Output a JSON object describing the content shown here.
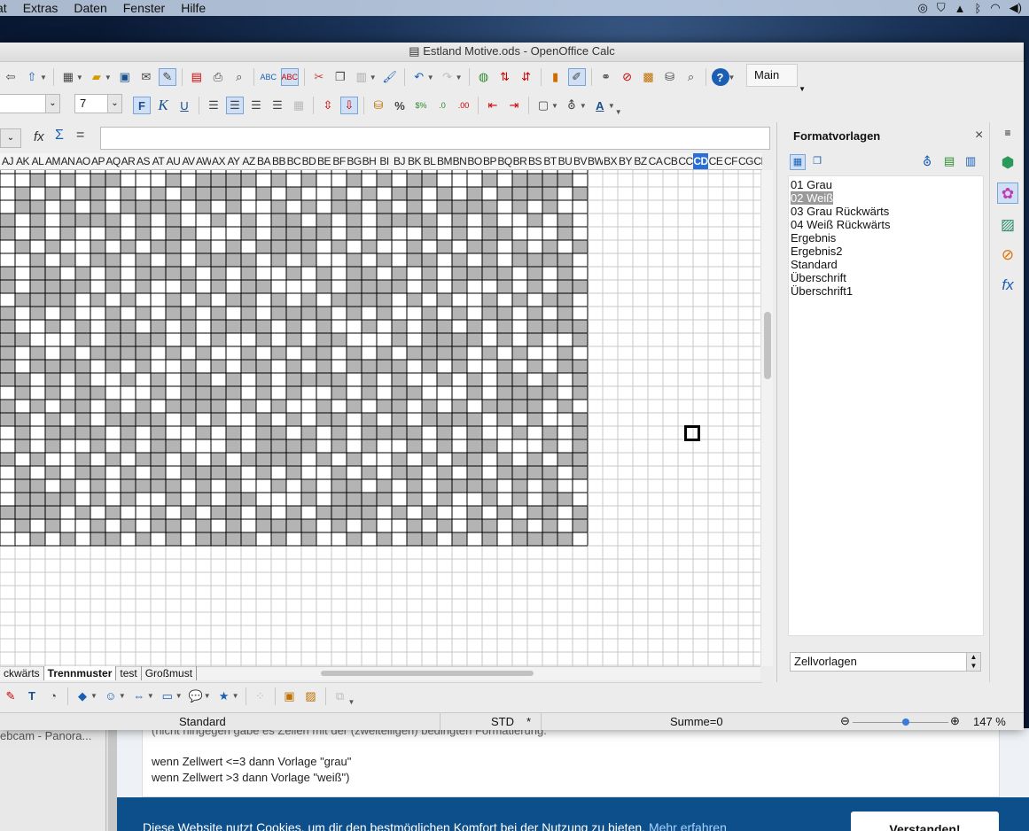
{
  "menubar": {
    "items": [
      "at",
      "Extras",
      "Daten",
      "Fenster",
      "Hilfe"
    ]
  },
  "window": {
    "title": "Estland Motive.ods - OpenOffice Calc"
  },
  "toolbar": {
    "main_label": "Main",
    "font_size": "7",
    "bold": "F",
    "italic": "K",
    "underline": "U",
    "percent": "%"
  },
  "formula": {
    "fx": "fx",
    "sigma": "Σ",
    "equals": "="
  },
  "columns": [
    "AJ",
    "AK",
    "AL",
    "AM",
    "AN",
    "AO",
    "AP",
    "AQ",
    "AR",
    "AS",
    "AT",
    "AU",
    "AV",
    "AW",
    "AX",
    "AY",
    "AZ",
    "BA",
    "BB",
    "BC",
    "BD",
    "BE",
    "BF",
    "BG",
    "BH",
    "BI",
    "BJ",
    "BK",
    "BL",
    "BM",
    "BN",
    "BO",
    "BP",
    "BQ",
    "BR",
    "BS",
    "BT",
    "BU",
    "BV",
    "BW",
    "BX",
    "BY",
    "BZ",
    "CA",
    "CB",
    "CC",
    "CD",
    "CE",
    "CF",
    "CG",
    "CH"
  ],
  "selected_column": "CD",
  "sheet_tabs": [
    "ckwärts",
    "Trennmuster",
    "test",
    "Großmust"
  ],
  "active_tab": "Trennmuster",
  "statusbar": {
    "style": "Standard",
    "mode": "STD",
    "modified": "*",
    "sum": "Summe=0",
    "zoom": "147 %"
  },
  "sidebar": {
    "title": "Formatvorlagen",
    "styles": [
      "01 Grau",
      "02 Weiß",
      "03 Grau Rückwärts",
      "04 Weiß Rückwärts",
      "Ergebnis",
      "Ergebnis2",
      "Standard",
      "Überschrift",
      "Überschrift1"
    ],
    "selected_style": "02 Weiß",
    "filter": "Zellvorlagen"
  },
  "browser": {
    "side_tab": "ebcam - Panora...",
    "text_top": "(nicht hingegen gäbe es Zellen mit der (zweiteiligen) bedingten Formatierung.",
    "line1": "wenn Zellwert <=3 dann Vorlage \"grau\"",
    "line2": "wenn Zellwert >3 dann Vorlage \"weiß\")",
    "cookie_text": "Diese Website nutzt Cookies, um dir den bestmöglichen Komfort bei der Nutzung zu bieten.",
    "cookie_more": "Mehr erfahren",
    "cookie_button": "Verstanden!"
  },
  "colors": {
    "cell_gray": "#b4b4b4",
    "grid_line": "#c8c8c8",
    "selection_blue": "#2a6fd8"
  }
}
